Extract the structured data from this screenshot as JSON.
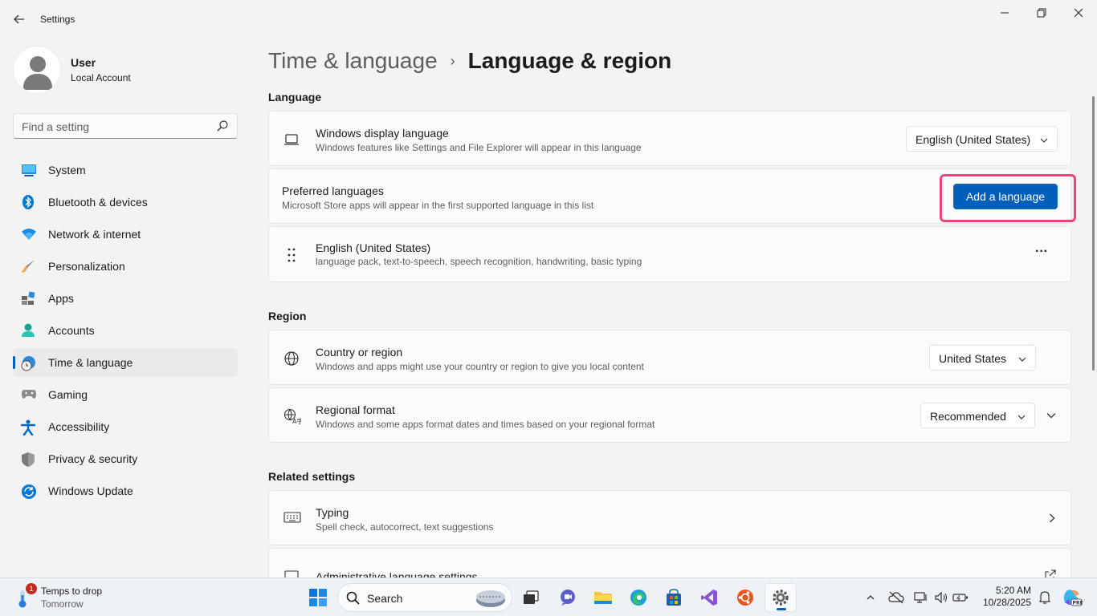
{
  "window": {
    "title": "Settings",
    "controls": [
      "minimize",
      "maximize",
      "close"
    ]
  },
  "profile": {
    "name": "User",
    "account_type": "Local Account"
  },
  "search": {
    "placeholder": "Find a setting"
  },
  "sidebar": {
    "items": [
      {
        "label": "System",
        "icon": "monitor-icon"
      },
      {
        "label": "Bluetooth & devices",
        "icon": "bluetooth-icon"
      },
      {
        "label": "Network & internet",
        "icon": "wifi-icon"
      },
      {
        "label": "Personalization",
        "icon": "brush-icon"
      },
      {
        "label": "Apps",
        "icon": "apps-icon"
      },
      {
        "label": "Accounts",
        "icon": "person-icon"
      },
      {
        "label": "Time & language",
        "icon": "globe-clock-icon",
        "active": true
      },
      {
        "label": "Gaming",
        "icon": "gamepad-icon"
      },
      {
        "label": "Accessibility",
        "icon": "accessibility-icon"
      },
      {
        "label": "Privacy & security",
        "icon": "shield-icon"
      },
      {
        "label": "Windows Update",
        "icon": "update-icon"
      }
    ]
  },
  "breadcrumb": {
    "parent": "Time & language",
    "separator": "›",
    "current": "Language & region"
  },
  "language": {
    "heading": "Language",
    "display_language": {
      "title": "Windows display language",
      "description": "Windows features like Settings and File Explorer will appear in this language",
      "value": "English (United States)"
    },
    "preferred": {
      "title": "Preferred languages",
      "description": "Microsoft Store apps will appear in the first supported language in this list",
      "button": "Add a language"
    },
    "installed": [
      {
        "name": "English (United States)",
        "features": "language pack, text-to-speech, speech recognition, handwriting, basic typing",
        "more": "···"
      }
    ]
  },
  "region": {
    "heading": "Region",
    "country": {
      "title": "Country or region",
      "description": "Windows and apps might use your country or region to give you local content",
      "value": "United States"
    },
    "format": {
      "title": "Regional format",
      "description": "Windows and some apps format dates and times based on your regional format",
      "value": "Recommended"
    }
  },
  "related": {
    "heading": "Related settings",
    "typing": {
      "title": "Typing",
      "description": "Spell check, autocorrect, text suggestions"
    },
    "admin": {
      "title": "Administrative language settings"
    }
  },
  "taskbar": {
    "weather": {
      "title": "Temps to drop",
      "subtitle": "Tomorrow",
      "badge": "1"
    },
    "search_placeholder": "Search",
    "apps": [
      "start-icon",
      "search",
      "task-view-icon",
      "copilot-chat-icon",
      "file-explorer-icon",
      "edge-icon",
      "store-icon",
      "visual-studio-icon",
      "ubuntu-icon",
      "settings-icon"
    ],
    "clock": {
      "time": "5:20 AM",
      "date": "10/28/2025"
    }
  },
  "colors": {
    "accent": "#005fb8",
    "highlight": "#e8457a",
    "background": "#f3f3f3",
    "card": "#fbfbfb"
  }
}
